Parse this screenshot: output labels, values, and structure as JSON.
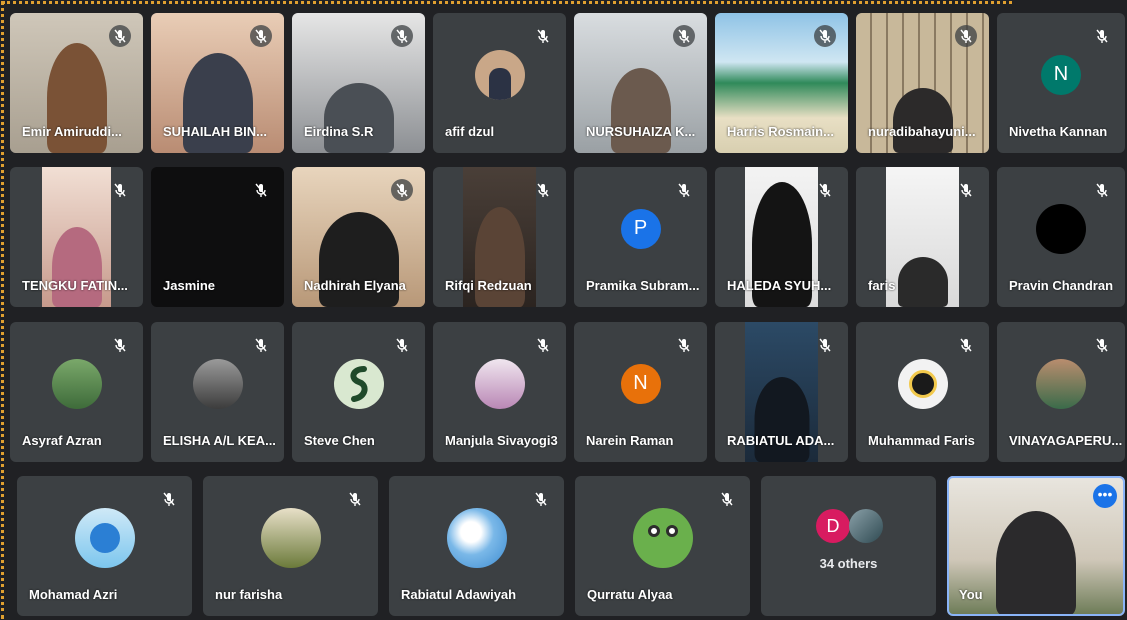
{
  "participants": [
    {
      "name": "Emir Amiruddin",
      "display": "Emir Amiruddi..."
    },
    {
      "name": "SUHAILAH BIN",
      "display": "SUHAILAH BIN..."
    },
    {
      "name": "Eirdina S.R",
      "display": "Eirdina S.R"
    },
    {
      "name": "afif dzul",
      "display": "afif dzul"
    },
    {
      "name": "NURSUHAIZA K",
      "display": "NURSUHAIZA K..."
    },
    {
      "name": "Harris Rosmain",
      "display": "Harris Rosmain..."
    },
    {
      "name": "nuradibahayuni",
      "display": "nuradibahayuni..."
    },
    {
      "name": "Nivetha Kannan",
      "display": "Nivetha Kannan",
      "avatar_letter": "N",
      "avatar_color": "#00796b"
    },
    {
      "name": "TENGKU FATIN",
      "display": "TENGKU FATIN..."
    },
    {
      "name": "Jasmine",
      "display": "Jasmine"
    },
    {
      "name": "Nadhirah Elyana",
      "display": "Nadhirah Elyana"
    },
    {
      "name": "Rifqi Redzuan",
      "display": "Rifqi Redzuan"
    },
    {
      "name": "Pramika Subram",
      "display": "Pramika Subram...",
      "avatar_letter": "P",
      "avatar_color": "#1a73e8"
    },
    {
      "name": "HALEDA SYUH",
      "display": "HALEDA SYUH..."
    },
    {
      "name": "faris",
      "display": "faris"
    },
    {
      "name": "Pravin Chandran",
      "display": "Pravin Chandran"
    },
    {
      "name": "Asyraf Azran",
      "display": "Asyraf Azran"
    },
    {
      "name": "ELISHA A/L KEA",
      "display": "ELISHA A/L KEA..."
    },
    {
      "name": "Steve Chen",
      "display": "Steve Chen"
    },
    {
      "name": "Manjula Sivayogi3",
      "display": "Manjula Sivayogi3"
    },
    {
      "name": "Narein Raman",
      "display": "Narein Raman",
      "avatar_letter": "N",
      "avatar_color": "#e8710a"
    },
    {
      "name": "RABIATUL ADA",
      "display": "RABIATUL ADA..."
    },
    {
      "name": "Muhammad Faris",
      "display": "Muhammad Faris"
    },
    {
      "name": "VINAYAGAPERU",
      "display": "VINAYAGAPERU..."
    },
    {
      "name": "Mohamad Azri",
      "display": "Mohamad Azri"
    },
    {
      "name": "nur farisha",
      "display": "nur farisha"
    },
    {
      "name": "Rabiatul Adawiyah",
      "display": "Rabiatul Adawiyah"
    },
    {
      "name": "Qurratu Alyaa",
      "display": "Qurratu Alyaa"
    }
  ],
  "others_tile": {
    "label": "34 others",
    "avatar_letter": "D",
    "avatar_color": "#d81b60"
  },
  "self_tile": {
    "label": "You",
    "more_options": "•••",
    "accent": "#1a73e8"
  },
  "colors": {
    "background": "#202124",
    "tile": "#3c4043",
    "frame_dots": "#e0a030"
  }
}
